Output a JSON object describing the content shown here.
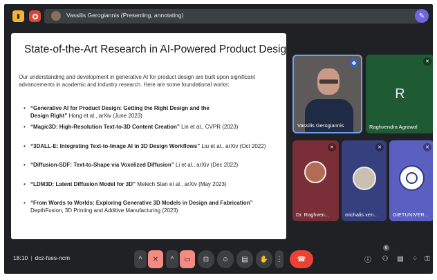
{
  "topbar": {
    "presenter_label": "Vassilis Gerogiannis (Presenting, annotating)"
  },
  "slide": {
    "title": "State-of-the-Art Research in AI-Powered Product Design",
    "intro": "Our understanding and development in generative AI for product design are built upon significant advancements in academic and industry research. Here are some foundational works:",
    "bullet": "•",
    "references": [
      {
        "title": "“Generative AI for Product Design: Getting the Right Design and the Design Right”",
        "detail": " Hong et al., arXiv (June 2023)"
      },
      {
        "title": "“Magic3D: High-Resolution Text-to-3D Content Creation”",
        "detail": " Lin et al., CVPR (2023)"
      },
      {
        "title": "“3DALL-E: Integrating Text-to-Image AI in 3D Design Workflows”",
        "detail": " Liu et al., arXiv (Oct 2022)"
      },
      {
        "title": "“Diffusion-SDF: Text-to-Shape via Voxelized Diffusion”",
        "detail": " Li et al., arXiv (Dec 2022)"
      },
      {
        "title": "“LDM3D: Latent Diffusion Model for 3D”",
        "detail": " Melech Stan et al., arXiv (May 2023)"
      },
      {
        "title": "“From Words to Worlds: Exploring Generative 3D Models in Design and Fabrication”",
        "detail": " DepthFusion, 3D Printing and Additive Manufacturing (2023)"
      }
    ]
  },
  "participants": [
    {
      "name": "Vassilis Gerogiannis",
      "status": "speaking",
      "tile_color": "#5d5a59"
    },
    {
      "name": "Raghvendra Agrawal",
      "initial": "R",
      "status": "muted",
      "tile_color": "#1e5a34"
    },
    {
      "name": "Dr. Raghven...",
      "status": "muted",
      "tile_color": "#7a2e38"
    },
    {
      "name": "michalis xen...",
      "status": "muted",
      "tile_color": "#37407e"
    },
    {
      "name": "GIETUNIVER...",
      "status": "muted",
      "tile_color": "#5a5fc0"
    }
  ],
  "bottombar": {
    "time": "18:10",
    "separator": "|",
    "meeting_code": "dcz-fses-ncm",
    "participant_count": "6"
  },
  "colors": {
    "background": "#202124",
    "accent_blue": "#6aa2f8",
    "end_call_red": "#ea4335",
    "muted_control": "#f28b82"
  }
}
